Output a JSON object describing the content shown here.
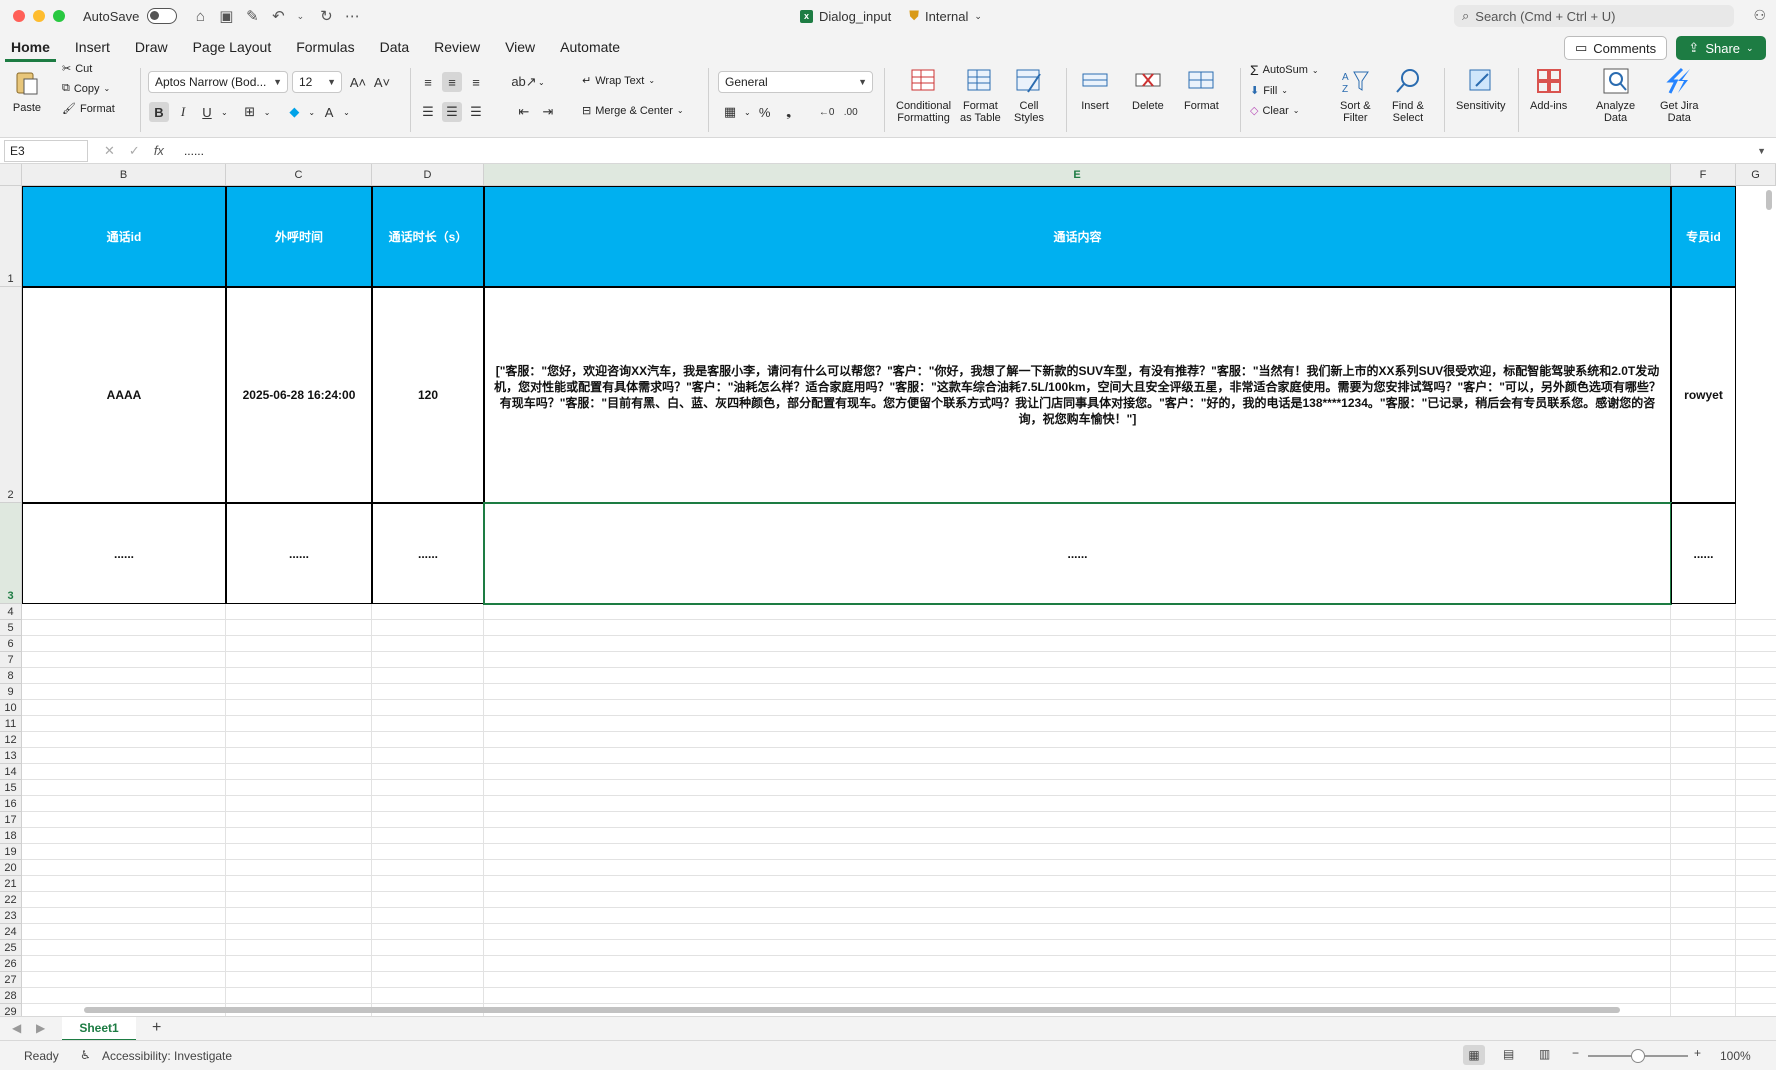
{
  "titlebar": {
    "autosave": "AutoSave",
    "doc_title": "Dialog_input",
    "sensitivity": "Internal",
    "search_placeholder": "Search (Cmd + Ctrl + U)"
  },
  "tabs": [
    "Home",
    "Insert",
    "Draw",
    "Page Layout",
    "Formulas",
    "Data",
    "Review",
    "View",
    "Automate"
  ],
  "buttons": {
    "comments": "Comments",
    "share": "Share"
  },
  "ribbon": {
    "paste": "Paste",
    "cut": "Cut",
    "copy": "Copy",
    "format": "Format",
    "font_name": "Aptos Narrow (Bod...",
    "font_size": "12",
    "bold": "B",
    "italic": "I",
    "underline": "U",
    "wrap_text": "Wrap Text",
    "merge_center": "Merge & Center",
    "number_format": "General",
    "cond_fmt_1": "Conditional",
    "cond_fmt_2": "Formatting",
    "fmt_table_1": "Format",
    "fmt_table_2": "as Table",
    "cell_styles_1": "Cell",
    "cell_styles_2": "Styles",
    "insert": "Insert",
    "delete": "Delete",
    "format_cells": "Format",
    "autosum": "AutoSum",
    "fill": "Fill",
    "clear": "Clear",
    "sort_1": "Sort &",
    "sort_2": "Filter",
    "find_1": "Find &",
    "find_2": "Select",
    "sensitivity": "Sensitivity",
    "addins": "Add-ins",
    "analyze_1": "Analyze",
    "analyze_2": "Data",
    "jira_1": "Get Jira",
    "jira_2": "Data"
  },
  "formula_bar": {
    "name_box": "E3",
    "value": "......"
  },
  "columns": [
    "B",
    "C",
    "D",
    "E",
    "F",
    "G"
  ],
  "rows": [
    "1",
    "2",
    "3",
    "4",
    "5",
    "6",
    "7",
    "8",
    "9",
    "10",
    "11",
    "12",
    "13",
    "14",
    "15",
    "16",
    "17",
    "18",
    "19",
    "20",
    "21",
    "22",
    "23",
    "24",
    "25",
    "26",
    "27",
    "28",
    "29"
  ],
  "table": {
    "headers": [
      "通话id",
      "外呼时间",
      "通话时长（s）",
      "通话内容",
      "专员id"
    ],
    "row2": [
      "AAAA",
      "2025-06-28 16:24:00",
      "120",
      "[\"客服：\"您好，欢迎咨询XX汽车，我是客服小李，请问有什么可以帮您？\"客户：\"你好，我想了解一下新款的SUV车型，有没有推荐？\"客服：\"当然有！我们新上市的XX系列SUV很受欢迎，标配智能驾驶系统和2.0T发动机，您对性能或配置有具体需求吗？\"客户：\"油耗怎么样？适合家庭用吗？\"客服：\"这款车综合油耗7.5L/100km，空间大且安全评级五星，非常适合家庭使用。需要为您安排试驾吗？\"客户：\"可以，另外颜色选项有哪些？有现车吗？\"客服：\"目前有黑、白、蓝、灰四种颜色，部分配置有现车。您方便留个联系方式吗？我让门店同事具体对接您。\"客户：\"好的，我的电话是138****1234。\"客服：\"已记录，稍后会有专员联系您。感谢您的咨询，祝您购车愉快！\"]",
      "rowyet"
    ],
    "row3": [
      "......",
      "......",
      "......",
      "......",
      "......"
    ]
  },
  "sheet": {
    "name": "Sheet1",
    "add": "+"
  },
  "status": {
    "ready": "Ready",
    "accessibility": "Accessibility: Investigate",
    "zoom": "100%"
  },
  "colors": {
    "accent": "#1d7c43",
    "header_fill": "#00b0f0"
  }
}
